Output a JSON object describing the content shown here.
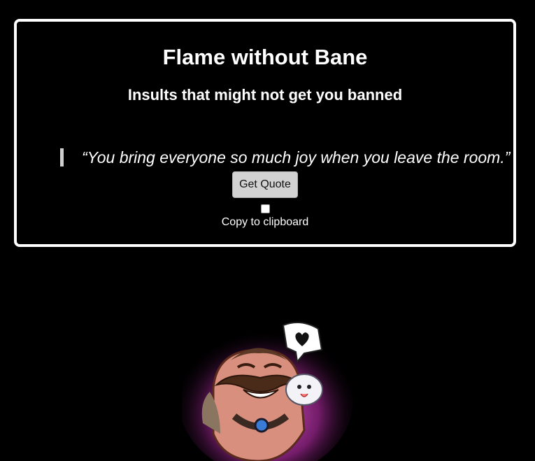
{
  "header": {
    "title": "Flame without Bane",
    "subtitle": "Insults that might not get you banned"
  },
  "quote": {
    "text": "“You bring everyone so much joy when you leave the room.”"
  },
  "controls": {
    "get_quote_label": "Get Quote",
    "copy_label": "Copy to clipboard",
    "copy_checked": false
  },
  "mascot": {
    "icon": "heart-icon",
    "glow_color": "#d13fc0"
  }
}
